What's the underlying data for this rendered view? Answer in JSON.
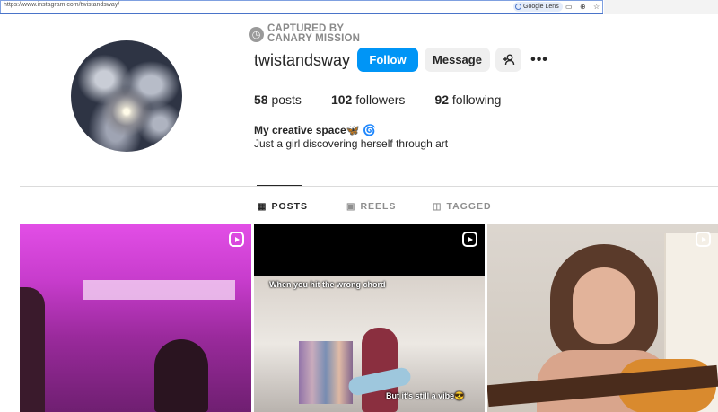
{
  "browser": {
    "url": "https://www.instagram.com/twistandsway/",
    "lens_label": "Google Lens"
  },
  "watermark": {
    "line1": "CAPTURED BY",
    "line2": "CANARY MISSION"
  },
  "profile": {
    "username": "twistandsway",
    "follow_label": "Follow",
    "message_label": "Message",
    "more_label": "•••",
    "stats": {
      "posts_count": "58",
      "posts_label": "posts",
      "followers_count": "102",
      "followers_label": "followers",
      "following_count": "92",
      "following_label": "following"
    },
    "bio_title": "My creative space🦋 🌀",
    "bio_text": "Just a girl discovering herself through art"
  },
  "tabs": [
    {
      "label": "POSTS",
      "icon": "grid-icon",
      "active": true
    },
    {
      "label": "REELS",
      "icon": "reels-icon",
      "active": false
    },
    {
      "label": "TAGGED",
      "icon": "tagged-icon",
      "active": false
    }
  ],
  "grid": {
    "tiles": [
      {
        "type": "reel"
      },
      {
        "type": "reel",
        "caption_top": "When you hit the wrong chord",
        "caption_bottom": "But it's still a vibe😎"
      },
      {
        "type": "reel"
      }
    ]
  },
  "colors": {
    "follow": "#0095f6",
    "secondary_button": "#efefef"
  }
}
